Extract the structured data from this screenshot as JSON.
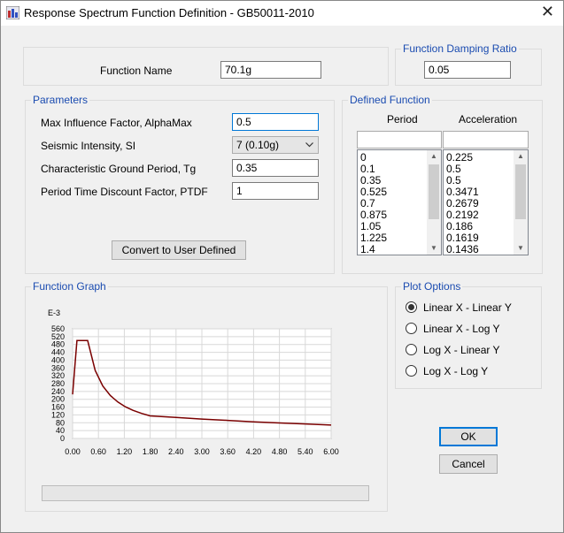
{
  "window": {
    "title": "Response Spectrum Function Definition - GB50011-2010"
  },
  "name_group": {
    "label": "Function Name",
    "value": "70.1g"
  },
  "damping_group": {
    "title": "Function Damping Ratio",
    "value": "0.05"
  },
  "parameters": {
    "title": "Parameters",
    "alpha_max_label": "Max Influence Factor, AlphaMax",
    "alpha_max_value": "0.5",
    "si_label": "Seismic Intensity, SI",
    "si_value": "7 (0.10g)",
    "tg_label": "Characteristic Ground Period, Tg",
    "tg_value": "0.35",
    "ptdf_label": "Period Time Discount Factor, PTDF",
    "ptdf_value": "1",
    "convert_button": "Convert to User Defined"
  },
  "defined_function": {
    "title": "Defined Function",
    "period_header": "Period",
    "accel_header": "Acceleration",
    "periods": [
      "0",
      "0.1",
      "0.35",
      "0.525",
      "0.7",
      "0.875",
      "1.05",
      "1.225",
      "1.4"
    ],
    "accelerations": [
      "0.225",
      "0.5",
      "0.5",
      "0.3471",
      "0.2679",
      "0.2192",
      "0.186",
      "0.1619",
      "0.1436"
    ]
  },
  "graph": {
    "title": "Function Graph",
    "exponent_label": "E-3",
    "y_ticks": [
      "560",
      "520",
      "480",
      "440",
      "400",
      "360",
      "320",
      "280",
      "240",
      "200",
      "160",
      "120",
      "80",
      "40",
      "0"
    ],
    "x_ticks": [
      "0.00",
      "0.60",
      "1.20",
      "1.80",
      "2.40",
      "3.00",
      "3.60",
      "4.20",
      "4.80",
      "5.40",
      "6.00"
    ]
  },
  "chart_data": {
    "type": "line",
    "title": "",
    "xlabel": "",
    "ylabel": "E-3",
    "xlim": [
      0,
      6
    ],
    "ylim": [
      0,
      560
    ],
    "grid": true,
    "line_color": "#7a0000",
    "x": [
      0,
      0.1,
      0.35,
      0.525,
      0.7,
      0.875,
      1.05,
      1.225,
      1.4,
      1.6,
      1.8,
      2.4,
      3.0,
      3.6,
      4.2,
      4.8,
      5.4,
      6.0
    ],
    "y": [
      225,
      500,
      500,
      347.1,
      267.9,
      219.2,
      186,
      161.9,
      143.6,
      128,
      115,
      107,
      99,
      92,
      85,
      79,
      74,
      68
    ]
  },
  "plot_options": {
    "title": "Plot Options",
    "options": [
      "Linear X - Linear Y",
      "Linear X - Log Y",
      "Log X - Linear Y",
      "Log X - Log Y"
    ],
    "selected_index": 0
  },
  "buttons": {
    "ok": "OK",
    "cancel": "Cancel"
  }
}
